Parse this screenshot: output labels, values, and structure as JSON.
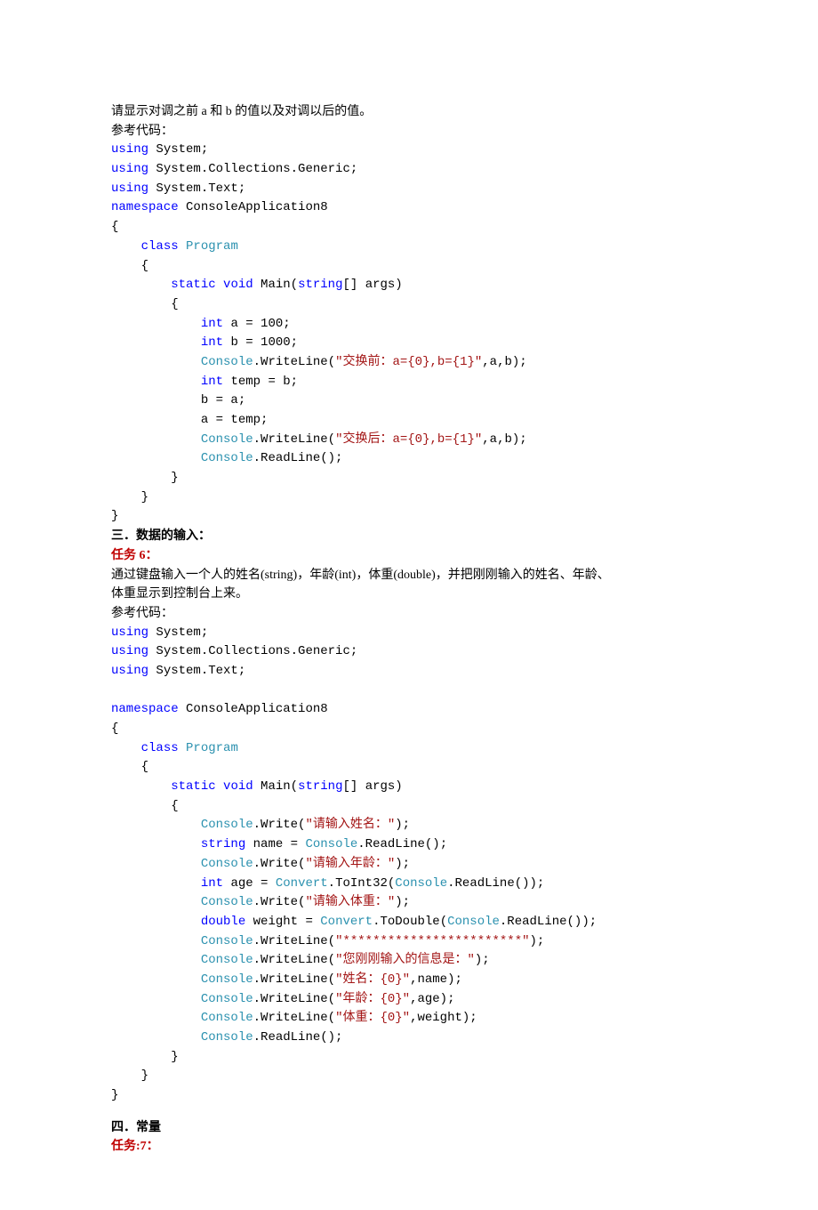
{
  "intro1": "请显示对调之前 a 和 b 的值以及对调以后的值。",
  "refCode": "参考代码：",
  "code1": {
    "using": "using",
    "System": " System;",
    "SystemCG": " System.Collections.Generic;",
    "SystemText": " System.Text;",
    "namespace": "namespace",
    "nsName": " ConsoleApplication8",
    "lbrace": "{",
    "rbrace": "}",
    "class": "class",
    "className": "Program",
    "static": "static",
    "void": "void",
    "main": " Main(",
    "string": "string",
    "stringArr": "[] args)",
    "int": "int",
    "aDecl": " a = 100;",
    "bDecl": " b = 1000;",
    "Console": "Console",
    "wl1a": ".WriteLine(",
    "str1": "\"交换前：a={0},b={1}\"",
    "wl1b": ",a,b);",
    "tempDecl": " temp = b;",
    "ba": "b = a;",
    "atemp": "a = temp;",
    "str2": "\"交换后：a={0},b={1}\"",
    "readLine": ".ReadLine();"
  },
  "section3": "三．数据的输入：",
  "task6": "任务 6：",
  "task6desc1": "通过键盘输入一个人的姓名(string)，年龄(int)，体重(double)，并把刚刚输入的姓名、年龄、",
  "task6desc2": "体重显示到控制台上来。",
  "code2": {
    "using": "using",
    "System": " System;",
    "SystemCG": " System.Collections.Generic;",
    "SystemText": " System.Text;",
    "namespace": "namespace",
    "nsName": " ConsoleApplication8",
    "lbrace": "{",
    "rbrace": "}",
    "class": "class",
    "className": "Program",
    "static": "static",
    "void": "void",
    "main": " Main(",
    "string": "string",
    "stringArr": "[] args)",
    "Console": "Console",
    "writeA": ".Write(",
    "str_name": "\"请输入姓名：\"",
    "paren_semi": ");",
    "string2": "string",
    "nameDecl": " name = ",
    "readLine": ".ReadLine();",
    "str_age": "\"请输入年龄：\"",
    "int": "int",
    "ageDecl": " age = ",
    "Convert": "Convert",
    "toInt32a": ".ToInt32(",
    "readLineInner": ".ReadLine());",
    "str_weight": "\"请输入体重：\"",
    "double": "double",
    "weightDecl": " weight = ",
    "toDoubleA": ".ToDouble(",
    "wlA": ".WriteLine(",
    "str_stars": "\"************************\"",
    "str_info": "\"您刚刚输入的信息是：\"",
    "str_nameVal": "\"姓名：{0}\"",
    "nameArg": ",name);",
    "str_ageVal": "\"年龄：{0}\"",
    "ageArg": ",age);",
    "str_weightVal": "\"体重：{0}\"",
    "weightArg": ",weight);"
  },
  "section4": "四．常量",
  "task7": "任务:7："
}
